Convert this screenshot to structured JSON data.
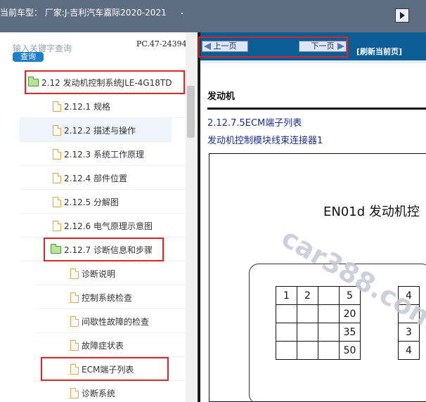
{
  "header": {
    "vehicle_text": "当前车型：  厂家:J-吉利汽车嘉际2020-2021"
  },
  "search": {
    "placeholder": "输入关键字查询",
    "button_label": "查询"
  },
  "pc_code": "PC.47-24394",
  "tree": [
    {
      "label": "2.12 发动机控制系统JLE-4G18TD",
      "icon": "folder"
    },
    {
      "label": "2.12.1 规格",
      "icon": "page"
    },
    {
      "label": "2.12.2 描述与操作",
      "icon": "page"
    },
    {
      "label": "2.12.3 系统工作原理",
      "icon": "page"
    },
    {
      "label": "2.12.4 部件位置",
      "icon": "page"
    },
    {
      "label": "2.12.5 分解图",
      "icon": "page"
    },
    {
      "label": "2.12.6 电气原理示意图",
      "icon": "page"
    },
    {
      "label": "2.12.7 诊断信息和步骤",
      "icon": "folder"
    },
    {
      "label": "诊断说明",
      "icon": "page"
    },
    {
      "label": "控制系统检查",
      "icon": "page"
    },
    {
      "label": "间歇性故障的检查",
      "icon": "page"
    },
    {
      "label": "故障症状表",
      "icon": "page"
    },
    {
      "label": "ECM端子列表",
      "icon": "page"
    },
    {
      "label": "诊断系统",
      "icon": "page"
    }
  ],
  "nav": {
    "prev_label": "上一页",
    "next_label": "下一页",
    "refresh_label": "[刷新当前页]"
  },
  "document": {
    "section": "发动机",
    "subtitle": "2.12.7.5ECM端子列表",
    "subtitle2": "发动机控制模块线束连接器1",
    "connector_title": "EN01d 发动机控",
    "grid": [
      [
        "1",
        "2",
        "",
        "5"
      ],
      [
        "",
        "",
        "",
        "20"
      ],
      [
        "",
        "",
        "",
        "35"
      ],
      [
        "",
        "",
        "",
        "50"
      ]
    ],
    "grid_right": [
      "4",
      "",
      "3",
      "4"
    ],
    "watermark": "car388.com"
  }
}
